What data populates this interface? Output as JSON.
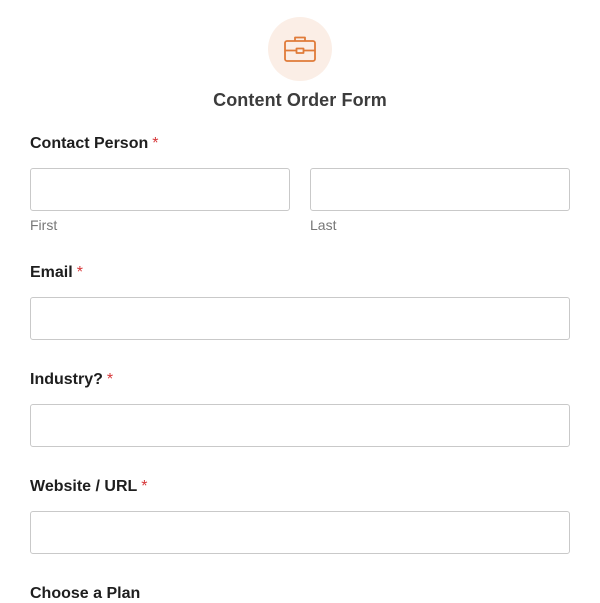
{
  "form": {
    "title": "Content Order Form",
    "icon": "briefcase-icon",
    "accent_color": "#e07b39",
    "icon_bg_color": "#fbeee6",
    "required_marker": "*",
    "required_color": "#d63638"
  },
  "fields": {
    "contact_person": {
      "label": "Contact Person",
      "first": {
        "value": "",
        "sublabel": "First"
      },
      "last": {
        "value": "",
        "sublabel": "Last"
      }
    },
    "email": {
      "label": "Email",
      "value": ""
    },
    "industry": {
      "label": "Industry?",
      "value": ""
    },
    "website": {
      "label": "Website / URL",
      "value": ""
    },
    "plan": {
      "label": "Choose a Plan"
    }
  }
}
